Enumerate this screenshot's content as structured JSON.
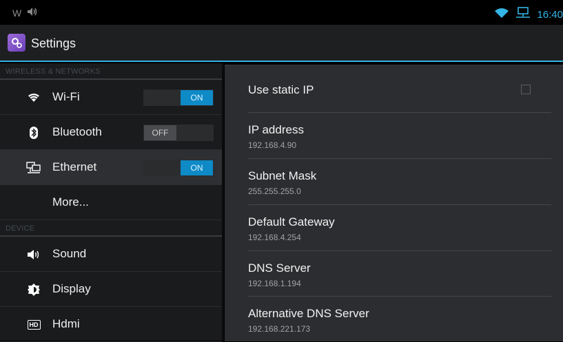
{
  "status_bar": {
    "left_icons": [
      "w-icon",
      "volume-icon"
    ],
    "left_glyph": "W",
    "time": "16:40",
    "accent": "#33b5e5"
  },
  "action_bar": {
    "title": "Settings",
    "icon": "settings-icon"
  },
  "sidebar": {
    "sections": [
      {
        "header": "WIRELESS & NETWORKS",
        "items": [
          {
            "label": "Wi-Fi",
            "icon": "wifi-icon",
            "toggle": "ON"
          },
          {
            "label": "Bluetooth",
            "icon": "bluetooth-icon",
            "toggle": "OFF"
          },
          {
            "label": "Ethernet",
            "icon": "ethernet-icon",
            "toggle": "ON",
            "selected": true
          },
          {
            "label": "More..."
          }
        ]
      },
      {
        "header": "DEVICE",
        "items": [
          {
            "label": "Sound",
            "icon": "speaker-icon"
          },
          {
            "label": "Display",
            "icon": "brightness-icon"
          },
          {
            "label": "Hdmi",
            "icon": "hdmi-icon",
            "icon_text": "HD"
          }
        ]
      }
    ]
  },
  "ethernet_settings": {
    "static_ip": {
      "label": "Use static IP",
      "checked": false
    },
    "fields": [
      {
        "label": "IP address",
        "value": "192.168.4.90"
      },
      {
        "label": "Subnet Mask",
        "value": "255.255.255.0"
      },
      {
        "label": "Default Gateway",
        "value": "192.168.4.254"
      },
      {
        "label": "DNS Server",
        "value": "192.168.1.194"
      },
      {
        "label": "Alternative DNS Server",
        "value": "192.168.221.173"
      }
    ]
  },
  "colors": {
    "accent": "#33b5e5",
    "toggle_on": "#0e8ac7",
    "background": "#000000"
  }
}
